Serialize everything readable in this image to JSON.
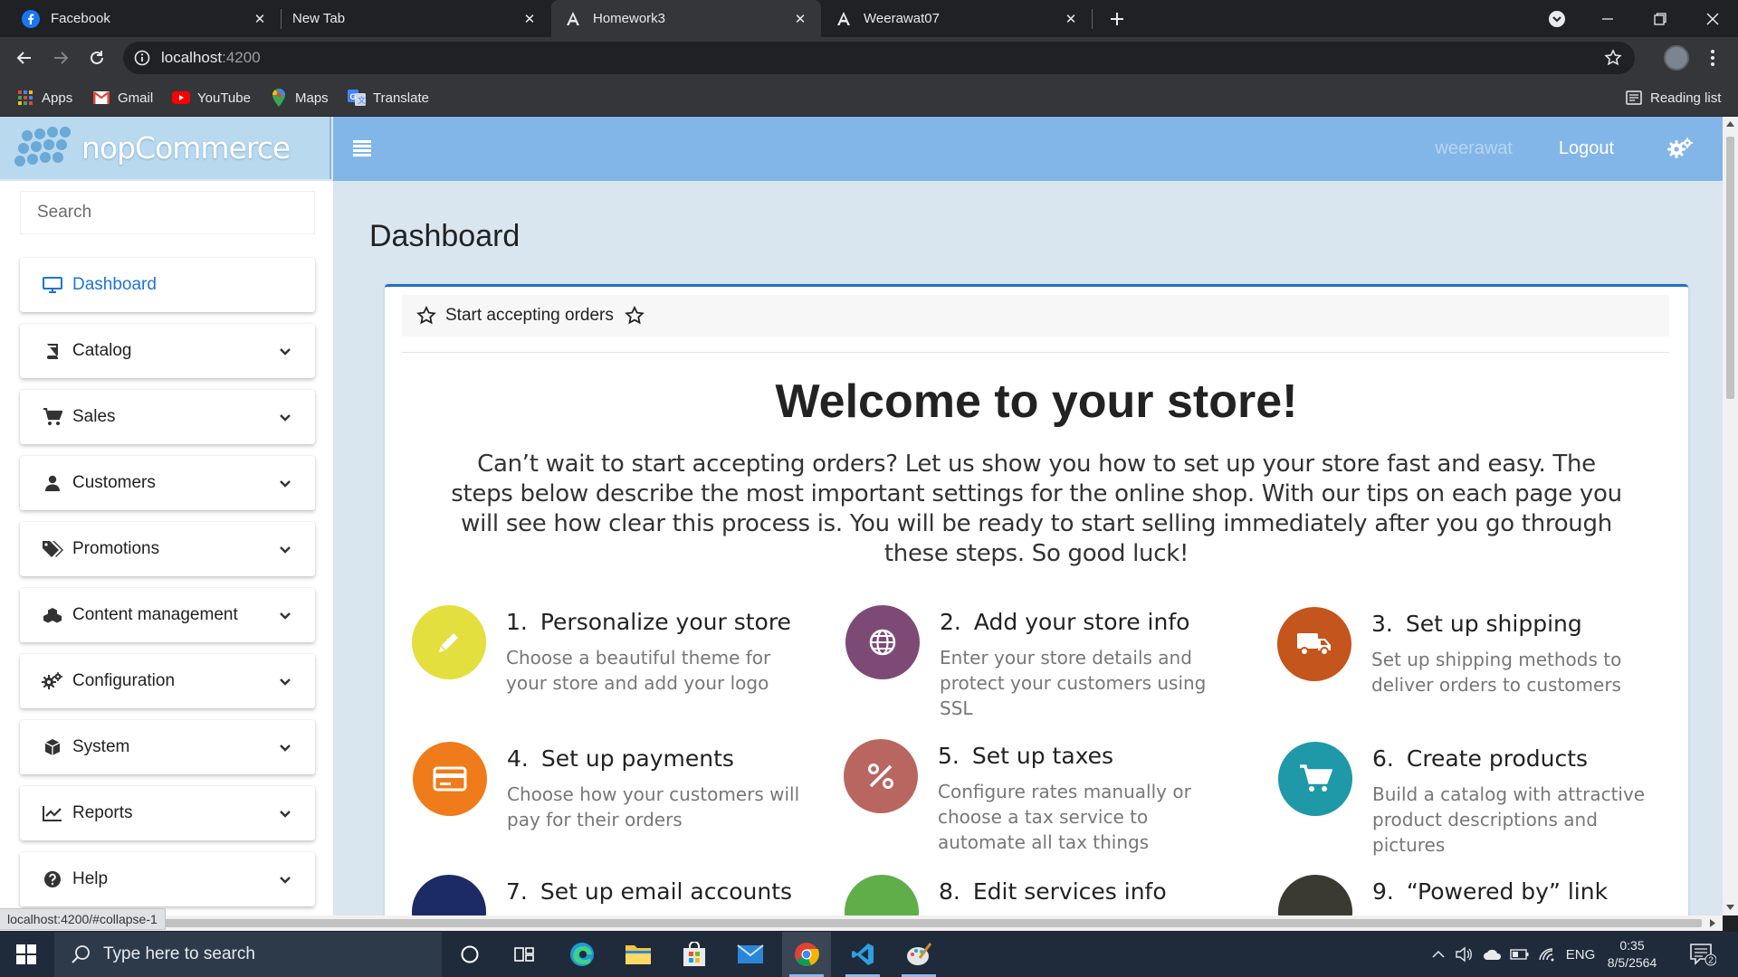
{
  "browser": {
    "tabs": [
      {
        "title": "Facebook",
        "icon": "facebook-icon",
        "active": false
      },
      {
        "title": "New Tab",
        "icon": "",
        "active": false
      },
      {
        "title": "Homework3",
        "icon": "angular-icon",
        "active": true
      },
      {
        "title": "Weerawat07",
        "icon": "angular-icon",
        "active": false
      }
    ],
    "url_host": "localhost",
    "url_port": ":4200",
    "bookmarks": [
      {
        "label": "Apps",
        "icon": "apps-grid-icon"
      },
      {
        "label": "Gmail",
        "icon": "gmail-icon"
      },
      {
        "label": "YouTube",
        "icon": "youtube-icon"
      },
      {
        "label": "Maps",
        "icon": "maps-icon"
      },
      {
        "label": "Translate",
        "icon": "translate-icon"
      }
    ],
    "reading_list": "Reading list",
    "status_url": "localhost:4200/#collapse-1"
  },
  "header": {
    "logo_text": "nopCommerce",
    "username": "weerawat",
    "logout_label": "Logout"
  },
  "sidebar": {
    "search_placeholder": "Search",
    "items": [
      {
        "label": "Dashboard",
        "icon": "monitor-icon",
        "expandable": false,
        "active": true
      },
      {
        "label": "Catalog",
        "icon": "book-icon",
        "expandable": true
      },
      {
        "label": "Sales",
        "icon": "cart-icon",
        "expandable": true
      },
      {
        "label": "Customers",
        "icon": "user-icon",
        "expandable": true
      },
      {
        "label": "Promotions",
        "icon": "tags-icon",
        "expandable": true
      },
      {
        "label": "Content management",
        "icon": "cubes-icon",
        "expandable": true
      },
      {
        "label": "Configuration",
        "icon": "cogs-icon",
        "expandable": true
      },
      {
        "label": "System",
        "icon": "cube-icon",
        "expandable": true
      },
      {
        "label": "Reports",
        "icon": "line-chart-icon",
        "expandable": true
      },
      {
        "label": "Help",
        "icon": "question-icon",
        "expandable": true
      }
    ]
  },
  "main": {
    "page_title": "Dashboard",
    "card_header": "Start accepting orders",
    "welcome_title": "Welcome to your store!",
    "intro": "Can’t wait to start accepting orders? Let us show you how to set up your store fast and easy. The steps below describe the most important settings for the online shop. With our tips on each page you will see how clear this process is. You will be ready to start selling immediately after you go through these steps. So good luck!",
    "steps": [
      {
        "num": "1.",
        "title": "Personalize your store",
        "desc": "Choose a beautiful theme for your store and add your logo",
        "icon": "pencil-icon",
        "color": "#e3df3e"
      },
      {
        "num": "2.",
        "title": "Add your store info",
        "desc": "Enter your store details and protect your customers using SSL",
        "icon": "globe-icon",
        "color": "#7d4a75"
      },
      {
        "num": "3.",
        "title": "Set up shipping",
        "desc": "Set up shipping methods to deliver orders to customers",
        "icon": "truck-icon",
        "color": "#c4551c"
      },
      {
        "num": "4.",
        "title": "Set up payments",
        "desc": "Choose how your customers will pay for their orders",
        "icon": "credit-card-icon",
        "color": "#f07b1a"
      },
      {
        "num": "5.",
        "title": "Set up taxes",
        "desc": "Configure rates manually or choose a tax service to automate all tax things",
        "icon": "percent-icon",
        "color": "#b96660"
      },
      {
        "num": "6.",
        "title": "Create products",
        "desc": "Build a catalog with attractive product descriptions and pictures",
        "icon": "cart-icon",
        "color": "#1f98a8"
      },
      {
        "num": "7.",
        "title": "Set up email accounts",
        "desc": "",
        "icon": "",
        "color": "#1c2a66"
      },
      {
        "num": "8.",
        "title": "Edit services info",
        "desc": "",
        "icon": "",
        "color": "#5fae4a"
      },
      {
        "num": "9.",
        "title": "“Powered by” link",
        "desc": "",
        "icon": "",
        "color": "#3a3a33"
      }
    ]
  },
  "taskbar": {
    "search_placeholder": "Type here to search",
    "language": "ENG",
    "time": "0:35",
    "date": "8/5/2564",
    "notifications": "2"
  }
}
